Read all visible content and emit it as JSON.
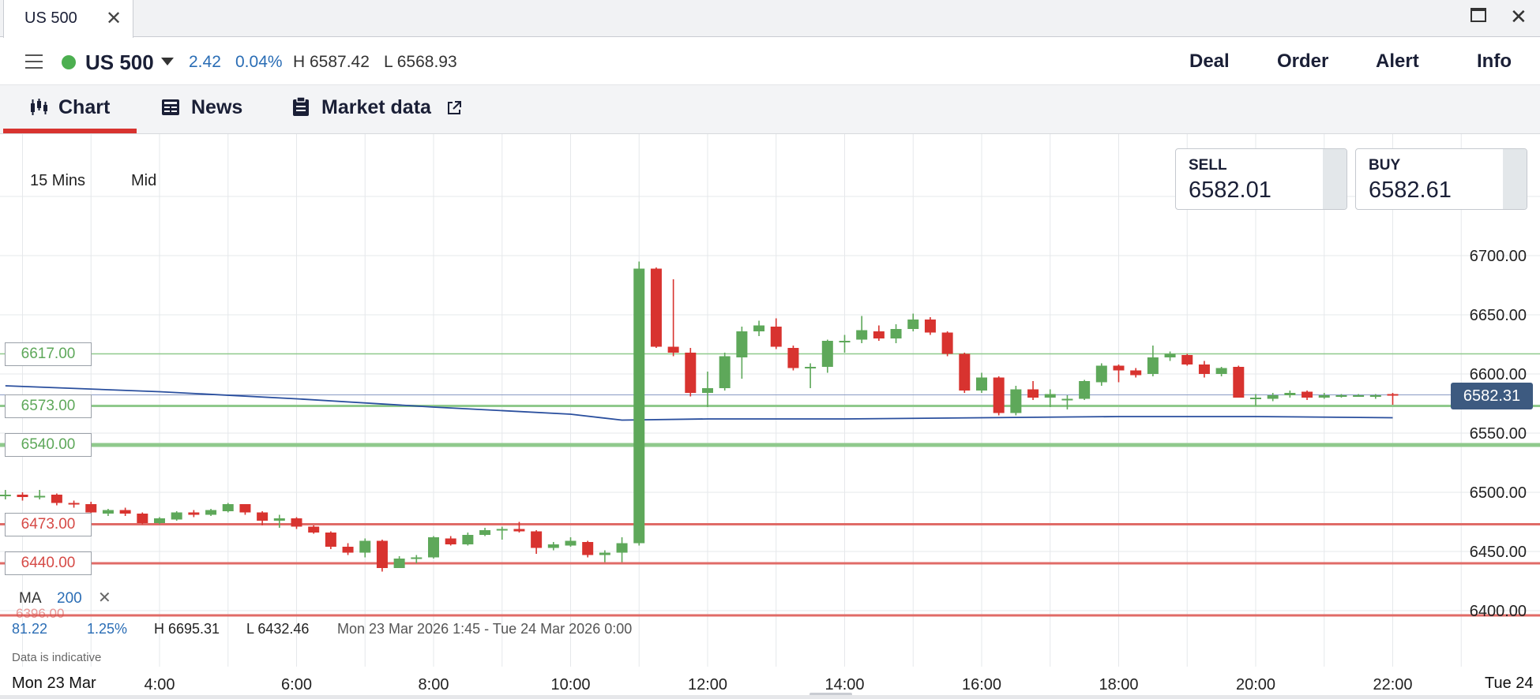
{
  "window": {
    "tab_title": "US 500",
    "close_icon": "close-icon",
    "maximize_icon": "maximize-icon"
  },
  "header": {
    "menu_icon": "hamburger-menu-icon",
    "instrument": "US 500",
    "change_points": "2.42",
    "change_percent": "0.04%",
    "day_high": "H 6587.42",
    "day_low": "L 6568.93",
    "actions": [
      "Deal",
      "Order",
      "Alert",
      "Info"
    ]
  },
  "tabs": [
    {
      "label": "Chart",
      "icon": "candlestick-icon",
      "active": true
    },
    {
      "label": "News",
      "icon": "newspaper-icon"
    },
    {
      "label": "Market data",
      "icon": "clipboard-icon",
      "external_icon": "external-link-icon"
    }
  ],
  "chart": {
    "timeframe": "15 Mins",
    "price_type": "Mid",
    "sell": {
      "label": "SELL",
      "price": "6582.01"
    },
    "buy": {
      "label": "BUY",
      "price": "6582.61"
    },
    "current_price": "6582.31",
    "indicator": {
      "name": "MA",
      "period": "200"
    },
    "range_change": "81.22",
    "range_change_pct": "1.25%",
    "range_high": "H 6695.31",
    "range_low": "L 6432.46",
    "range_span": "Mon 23 Mar 2026 1:45 - Tue 24 Mar 2026 0:00",
    "disclaimer": "Data is indicative",
    "date_start": "Mon 23 Mar",
    "date_end": "Tue 24",
    "colors": {
      "up": "#5ea85a",
      "down": "#d8332f",
      "ma": "#2a4f9e",
      "grid": "#e6e8eb"
    }
  },
  "chart_data": {
    "type": "candlestick",
    "title": "",
    "y_ticks": [
      6400,
      6450,
      6500,
      6550,
      6600,
      6650,
      6700
    ],
    "y_tick_labels": [
      "6400.00",
      "6450.00",
      "6500.00",
      "6550.00",
      "6600.00",
      "6650.00",
      "6700.00"
    ],
    "x_tick_labels": [
      "4:00",
      "6:00",
      "8:00",
      "10:00",
      "12:00",
      "14:00",
      "16:00",
      "18:00",
      "20:00",
      "22:00"
    ],
    "x_tick_hours": [
      4,
      6,
      8,
      10,
      12,
      14,
      16,
      18,
      20,
      22
    ],
    "x_range_hours": [
      1.75,
      24
    ],
    "ylim": [
      6386,
      6733
    ],
    "grid": true,
    "levels": [
      {
        "value": 6617.0,
        "label": "6617.00",
        "color": "green",
        "weight": "thin"
      },
      {
        "value": 6573.0,
        "label": "6573.00",
        "color": "green",
        "weight": "medium"
      },
      {
        "value": 6540.0,
        "label": "6540.00",
        "color": "green",
        "weight": "thick"
      },
      {
        "value": 6473.0,
        "label": "6473.00",
        "color": "red",
        "weight": "medium"
      },
      {
        "value": 6440.0,
        "label": "6440.00",
        "color": "red",
        "weight": "medium"
      },
      {
        "value": 6396.0,
        "label": "6396.00",
        "color": "red",
        "weight": "medium"
      }
    ],
    "current_price_line": 6582.31,
    "moving_average": {
      "name": "MA 200",
      "points": [
        [
          1.75,
          6590
        ],
        [
          4.0,
          6585
        ],
        [
          6.0,
          6579
        ],
        [
          8.0,
          6572
        ],
        [
          10.0,
          6566
        ],
        [
          10.75,
          6561
        ],
        [
          12.0,
          6562
        ],
        [
          14.0,
          6562
        ],
        [
          16.0,
          6563
        ],
        [
          18.0,
          6564
        ],
        [
          20.0,
          6564
        ],
        [
          22.0,
          6563
        ]
      ]
    },
    "candles": [
      {
        "t": 1.75,
        "o": 6498,
        "h": 6502,
        "l": 6494,
        "c": 6498
      },
      {
        "t": 2.0,
        "o": 6498,
        "h": 6500,
        "l": 6493,
        "c": 6496
      },
      {
        "t": 2.25,
        "o": 6496,
        "h": 6502,
        "l": 6494,
        "c": 6497
      },
      {
        "t": 2.5,
        "o": 6498,
        "h": 6499,
        "l": 6489,
        "c": 6491
      },
      {
        "t": 2.75,
        "o": 6491,
        "h": 6493,
        "l": 6487,
        "c": 6490
      },
      {
        "t": 3.0,
        "o": 6490,
        "h": 6492,
        "l": 6480,
        "c": 6483
      },
      {
        "t": 3.25,
        "o": 6482,
        "h": 6486,
        "l": 6480,
        "c": 6485
      },
      {
        "t": 3.5,
        "o": 6485,
        "h": 6487,
        "l": 6480,
        "c": 6482
      },
      {
        "t": 3.75,
        "o": 6482,
        "h": 6483,
        "l": 6473,
        "c": 6474
      },
      {
        "t": 4.0,
        "o": 6474,
        "h": 6479,
        "l": 6473,
        "c": 6478
      },
      {
        "t": 4.25,
        "o": 6477,
        "h": 6484,
        "l": 6476,
        "c": 6483
      },
      {
        "t": 4.5,
        "o": 6483,
        "h": 6485,
        "l": 6479,
        "c": 6481
      },
      {
        "t": 4.75,
        "o": 6481,
        "h": 6486,
        "l": 6480,
        "c": 6485
      },
      {
        "t": 5.0,
        "o": 6484,
        "h": 6491,
        "l": 6483,
        "c": 6490
      },
      {
        "t": 5.25,
        "o": 6490,
        "h": 6490,
        "l": 6481,
        "c": 6483
      },
      {
        "t": 5.5,
        "o": 6483,
        "h": 6484,
        "l": 6472,
        "c": 6476
      },
      {
        "t": 5.75,
        "o": 6476,
        "h": 6481,
        "l": 6470,
        "c": 6478
      },
      {
        "t": 6.0,
        "o": 6478,
        "h": 6479,
        "l": 6469,
        "c": 6471
      },
      {
        "t": 6.25,
        "o": 6471,
        "h": 6472,
        "l": 6465,
        "c": 6466
      },
      {
        "t": 6.5,
        "o": 6466,
        "h": 6467,
        "l": 6452,
        "c": 6454
      },
      {
        "t": 6.75,
        "o": 6454,
        "h": 6457,
        "l": 6447,
        "c": 6449
      },
      {
        "t": 7.0,
        "o": 6449,
        "h": 6461,
        "l": 6445,
        "c": 6459
      },
      {
        "t": 7.25,
        "o": 6459,
        "h": 6460,
        "l": 6433,
        "c": 6436
      },
      {
        "t": 7.5,
        "o": 6436,
        "h": 6446,
        "l": 6436,
        "c": 6444
      },
      {
        "t": 7.75,
        "o": 6444,
        "h": 6447,
        "l": 6440,
        "c": 6445
      },
      {
        "t": 8.0,
        "o": 6445,
        "h": 6463,
        "l": 6444,
        "c": 6462
      },
      {
        "t": 8.25,
        "o": 6461,
        "h": 6463,
        "l": 6455,
        "c": 6456
      },
      {
        "t": 8.5,
        "o": 6456,
        "h": 6466,
        "l": 6455,
        "c": 6464
      },
      {
        "t": 8.75,
        "o": 6464,
        "h": 6470,
        "l": 6463,
        "c": 6468
      },
      {
        "t": 9.0,
        "o": 6468,
        "h": 6471,
        "l": 6460,
        "c": 6469
      },
      {
        "t": 9.25,
        "o": 6469,
        "h": 6475,
        "l": 6466,
        "c": 6467
      },
      {
        "t": 9.5,
        "o": 6467,
        "h": 6468,
        "l": 6448,
        "c": 6453
      },
      {
        "t": 9.75,
        "o": 6453,
        "h": 6458,
        "l": 6451,
        "c": 6456
      },
      {
        "t": 10.0,
        "o": 6455,
        "h": 6462,
        "l": 6454,
        "c": 6459
      },
      {
        "t": 10.25,
        "o": 6458,
        "h": 6459,
        "l": 6445,
        "c": 6447
      },
      {
        "t": 10.5,
        "o": 6447,
        "h": 6451,
        "l": 6441,
        "c": 6449
      },
      {
        "t": 10.75,
        "o": 6449,
        "h": 6462,
        "l": 6441,
        "c": 6457
      },
      {
        "t": 11.0,
        "o": 6457,
        "h": 6695,
        "l": 6455,
        "c": 6689
      },
      {
        "t": 11.25,
        "o": 6689,
        "h": 6690,
        "l": 6622,
        "c": 6623
      },
      {
        "t": 11.5,
        "o": 6623,
        "h": 6680,
        "l": 6615,
        "c": 6618
      },
      {
        "t": 11.75,
        "o": 6618,
        "h": 6622,
        "l": 6581,
        "c": 6584
      },
      {
        "t": 12.0,
        "o": 6584,
        "h": 6602,
        "l": 6572,
        "c": 6588
      },
      {
        "t": 12.25,
        "o": 6588,
        "h": 6618,
        "l": 6586,
        "c": 6615
      },
      {
        "t": 12.5,
        "o": 6614,
        "h": 6640,
        "l": 6596,
        "c": 6636
      },
      {
        "t": 12.75,
        "o": 6636,
        "h": 6645,
        "l": 6632,
        "c": 6641
      },
      {
        "t": 13.0,
        "o": 6640,
        "h": 6647,
        "l": 6621,
        "c": 6623
      },
      {
        "t": 13.25,
        "o": 6622,
        "h": 6624,
        "l": 6603,
        "c": 6605
      },
      {
        "t": 13.5,
        "o": 6605,
        "h": 6609,
        "l": 6588,
        "c": 6606
      },
      {
        "t": 13.75,
        "o": 6606,
        "h": 6629,
        "l": 6601,
        "c": 6628
      },
      {
        "t": 14.0,
        "o": 6628,
        "h": 6633,
        "l": 6618,
        "c": 6628
      },
      {
        "t": 14.25,
        "o": 6629,
        "h": 6649,
        "l": 6626,
        "c": 6637
      },
      {
        "t": 14.5,
        "o": 6636,
        "h": 6641,
        "l": 6628,
        "c": 6630
      },
      {
        "t": 14.75,
        "o": 6630,
        "h": 6642,
        "l": 6626,
        "c": 6638
      },
      {
        "t": 15.0,
        "o": 6638,
        "h": 6651,
        "l": 6636,
        "c": 6646
      },
      {
        "t": 15.25,
        "o": 6646,
        "h": 6648,
        "l": 6633,
        "c": 6635
      },
      {
        "t": 15.5,
        "o": 6635,
        "h": 6636,
        "l": 6615,
        "c": 6617
      },
      {
        "t": 15.75,
        "o": 6617,
        "h": 6618,
        "l": 6584,
        "c": 6586
      },
      {
        "t": 16.0,
        "o": 6586,
        "h": 6601,
        "l": 6584,
        "c": 6597
      },
      {
        "t": 16.25,
        "o": 6597,
        "h": 6598,
        "l": 6565,
        "c": 6567
      },
      {
        "t": 16.5,
        "o": 6567,
        "h": 6590,
        "l": 6565,
        "c": 6587
      },
      {
        "t": 16.75,
        "o": 6587,
        "h": 6594,
        "l": 6578,
        "c": 6580
      },
      {
        "t": 17.0,
        "o": 6580,
        "h": 6587,
        "l": 6572,
        "c": 6583
      },
      {
        "t": 17.25,
        "o": 6578,
        "h": 6582,
        "l": 6570,
        "c": 6579
      },
      {
        "t": 17.5,
        "o": 6579,
        "h": 6595,
        "l": 6578,
        "c": 6594
      },
      {
        "t": 17.75,
        "o": 6593,
        "h": 6609,
        "l": 6590,
        "c": 6607
      },
      {
        "t": 18.0,
        "o": 6607,
        "h": 6608,
        "l": 6593,
        "c": 6603
      },
      {
        "t": 18.25,
        "o": 6603,
        "h": 6605,
        "l": 6597,
        "c": 6599
      },
      {
        "t": 18.5,
        "o": 6600,
        "h": 6624,
        "l": 6598,
        "c": 6614
      },
      {
        "t": 18.75,
        "o": 6614,
        "h": 6619,
        "l": 6611,
        "c": 6617
      },
      {
        "t": 19.0,
        "o": 6616,
        "h": 6617,
        "l": 6607,
        "c": 6608
      },
      {
        "t": 19.25,
        "o": 6608,
        "h": 6611,
        "l": 6597,
        "c": 6600
      },
      {
        "t": 19.5,
        "o": 6600,
        "h": 6606,
        "l": 6598,
        "c": 6605
      },
      {
        "t": 19.75,
        "o": 6606,
        "h": 6607,
        "l": 6580,
        "c": 6580
      },
      {
        "t": 20.0,
        "o": 6580,
        "h": 6583,
        "l": 6573,
        "c": 6580
      },
      {
        "t": 20.25,
        "o": 6579,
        "h": 6584,
        "l": 6577,
        "c": 6582
      },
      {
        "t": 20.5,
        "o": 6582,
        "h": 6586,
        "l": 6580,
        "c": 6584
      },
      {
        "t": 20.75,
        "o": 6585,
        "h": 6586,
        "l": 6578,
        "c": 6580
      },
      {
        "t": 21.0,
        "o": 6580,
        "h": 6584,
        "l": 6579,
        "c": 6582
      },
      {
        "t": 21.25,
        "o": 6582,
        "h": 6583,
        "l": 6580,
        "c": 6582
      },
      {
        "t": 21.5,
        "o": 6582,
        "h": 6583,
        "l": 6581,
        "c": 6582
      },
      {
        "t": 21.75,
        "o": 6582,
        "h": 6583,
        "l": 6579,
        "c": 6582
      },
      {
        "t": 22.0,
        "o": 6583,
        "h": 6584,
        "l": 6574,
        "c": 6582
      }
    ]
  }
}
